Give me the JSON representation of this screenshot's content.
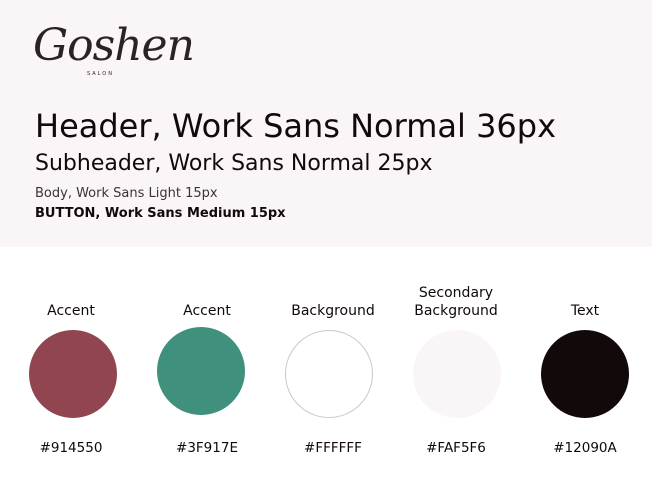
{
  "logo": {
    "name": "Goshen",
    "tagline": "SALON"
  },
  "typography": {
    "header": "Header, Work Sans Normal 36px",
    "subheader": "Subheader, Work Sans Normal 25px",
    "body": "Body, Work Sans Light 15px",
    "button": "BUTTON, Work Sans Medium 15px"
  },
  "swatches": [
    {
      "label_line1": "",
      "label_line2": "Accent",
      "hex": "#914550",
      "color": "#914550"
    },
    {
      "label_line1": "",
      "label_line2": "Accent",
      "hex": "#3F917E",
      "color": "#3F917E"
    },
    {
      "label_line1": "",
      "label_line2": "Background",
      "hex": "#FFFFFF",
      "color": "#FFFFFF"
    },
    {
      "label_line1": "Secondary",
      "label_line2": "Background",
      "hex": "#FAF5F6",
      "color": "#FAF5F6"
    },
    {
      "label_line1": "",
      "label_line2": "Text",
      "hex": "#12090A",
      "color": "#12090A"
    }
  ],
  "colors": {
    "panel_background": "#FAF5F6",
    "page_background": "#FFFFFF",
    "text": "#12090A"
  }
}
